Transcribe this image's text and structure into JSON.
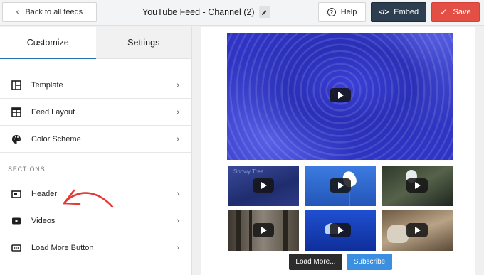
{
  "topbar": {
    "back_label": "Back to all feeds",
    "title": "YouTube Feed - Channel (2)",
    "help_label": "Help",
    "embed_label": "Embed",
    "save_label": "Save"
  },
  "sidebar": {
    "tabs": [
      {
        "label": "Customize",
        "active": true
      },
      {
        "label": "Settings",
        "active": false
      }
    ],
    "items": [
      {
        "label": "Template",
        "icon": "template-icon"
      },
      {
        "label": "Feed Layout",
        "icon": "feed-layout-icon"
      },
      {
        "label": "Color Scheme",
        "icon": "palette-icon"
      }
    ],
    "section_label": "SECTIONS",
    "section_items": [
      {
        "label": "Header",
        "icon": "header-icon"
      },
      {
        "label": "Videos",
        "icon": "video-icon"
      },
      {
        "label": "Load More Button",
        "icon": "load-more-icon"
      }
    ]
  },
  "preview": {
    "thumb_caption": "Snowy Tree",
    "load_more_label": "Load More...",
    "subscribe_label": "Subscribe"
  },
  "colors": {
    "embed_bg": "#2c3e50",
    "save_bg": "#e34f45",
    "tab_accent": "#2271b1",
    "subscribe_bg": "#3b8fe0",
    "annotation_arrow": "#e53935"
  }
}
